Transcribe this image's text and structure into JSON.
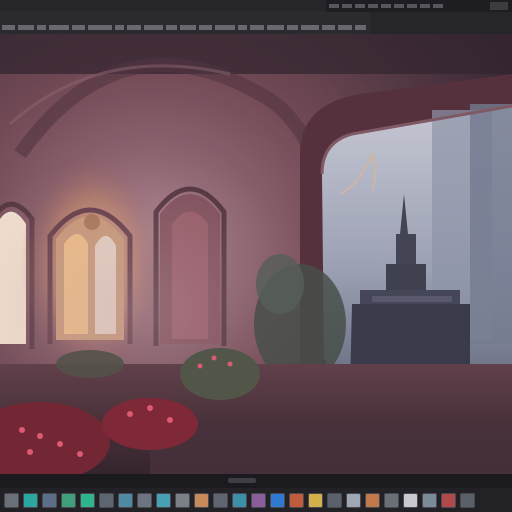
{
  "toolbar": {
    "menu_items": [
      "",
      "",
      "",
      "",
      "",
      "",
      "",
      "",
      "",
      "",
      "",
      "",
      "",
      "",
      "",
      "",
      "",
      "",
      "",
      "",
      ""
    ],
    "path_field": ""
  },
  "canvas": {
    "image_description_hidden": ""
  },
  "taskbar": {
    "items": [
      {
        "icon": "app-icon",
        "color": "#6b6f7a"
      },
      {
        "icon": "app-icon",
        "color": "#2aa7a0"
      },
      {
        "icon": "app-icon",
        "color": "#5a6e88"
      },
      {
        "icon": "app-icon",
        "color": "#3f9f7b"
      },
      {
        "icon": "app-icon",
        "color": "#2fb58c"
      },
      {
        "icon": "app-icon",
        "color": "#5c6670"
      },
      {
        "icon": "app-icon",
        "color": "#4f8aa3"
      },
      {
        "icon": "app-icon",
        "color": "#6d7380"
      },
      {
        "icon": "app-icon",
        "color": "#48a0b5"
      },
      {
        "icon": "app-icon",
        "color": "#7b7f88"
      },
      {
        "icon": "app-icon",
        "color": "#c78a5a"
      },
      {
        "icon": "app-icon",
        "color": "#5e6470"
      },
      {
        "icon": "app-icon",
        "color": "#3d8ea8"
      },
      {
        "icon": "app-icon",
        "color": "#8a5e9a"
      },
      {
        "icon": "app-icon",
        "color": "#2f7ad0"
      },
      {
        "icon": "app-icon",
        "color": "#c05c3c"
      },
      {
        "icon": "app-icon",
        "color": "#d4b04a"
      },
      {
        "icon": "app-icon",
        "color": "#5a606c"
      },
      {
        "icon": "app-icon",
        "color": "#9fa6b4"
      },
      {
        "icon": "app-icon",
        "color": "#c07a4a"
      },
      {
        "icon": "app-icon",
        "color": "#6a7078"
      },
      {
        "icon": "app-icon",
        "color": "#c9c9cf"
      },
      {
        "icon": "app-icon",
        "color": "#7a8a96"
      },
      {
        "icon": "app-icon",
        "color": "#b04a4a"
      },
      {
        "icon": "app-icon",
        "color": "#5a6068"
      }
    ]
  }
}
